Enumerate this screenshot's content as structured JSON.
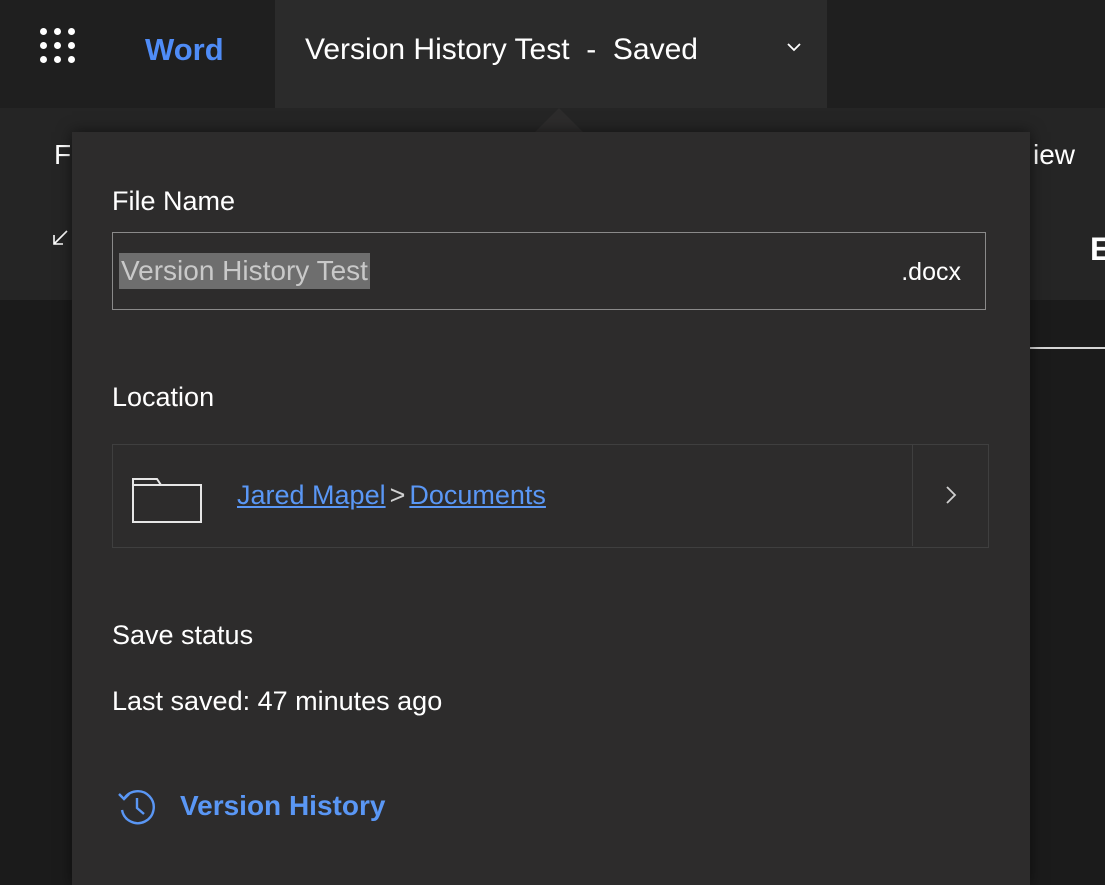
{
  "header": {
    "app_name": "Word",
    "doc_title": "Version History Test  -  Saved",
    "icons": {
      "launcher": "app-launcher-icon",
      "title_menu": "chevron-down-icon"
    }
  },
  "ribbon": {
    "left_fragment": "F",
    "right_fragment": "iew",
    "right_fragment_2": "E"
  },
  "panel": {
    "file_name_label": "File Name",
    "file_name_value": "Version History Test",
    "file_extension": ".docx",
    "location_label": "Location",
    "location_path": [
      "Jared Mapel",
      "Documents"
    ],
    "location_separator": ">",
    "save_status_label": "Save status",
    "last_saved_text": "Last saved: 47 minutes ago",
    "version_history_label": "Version History",
    "icons": {
      "folder": "folder-icon",
      "location_expand": "chevron-right-icon",
      "version_history": "history-icon"
    }
  },
  "colors": {
    "accent": "#4f8cf7",
    "link": "#5a97f5",
    "panel_bg": "#2d2c2c",
    "title_bg": "#2b2b2b"
  }
}
